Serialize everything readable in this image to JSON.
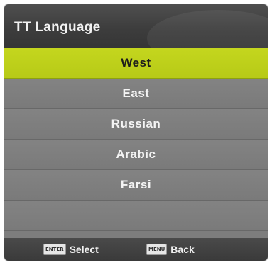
{
  "menu": {
    "title": "TT Language",
    "items": [
      {
        "label": "West",
        "selected": true
      },
      {
        "label": "East",
        "selected": false
      },
      {
        "label": "Russian",
        "selected": false
      },
      {
        "label": "Arabic",
        "selected": false
      },
      {
        "label": "Farsi",
        "selected": false
      },
      {
        "label": "",
        "selected": false
      }
    ]
  },
  "footer": {
    "select_key": "ENTER",
    "select_label": "Select",
    "back_key": "MENU",
    "back_label": "Back"
  },
  "colors": {
    "selected_bg": "#c4d61e",
    "item_bg": "#7d7d7d",
    "header_bg": "#3d3d3d"
  }
}
